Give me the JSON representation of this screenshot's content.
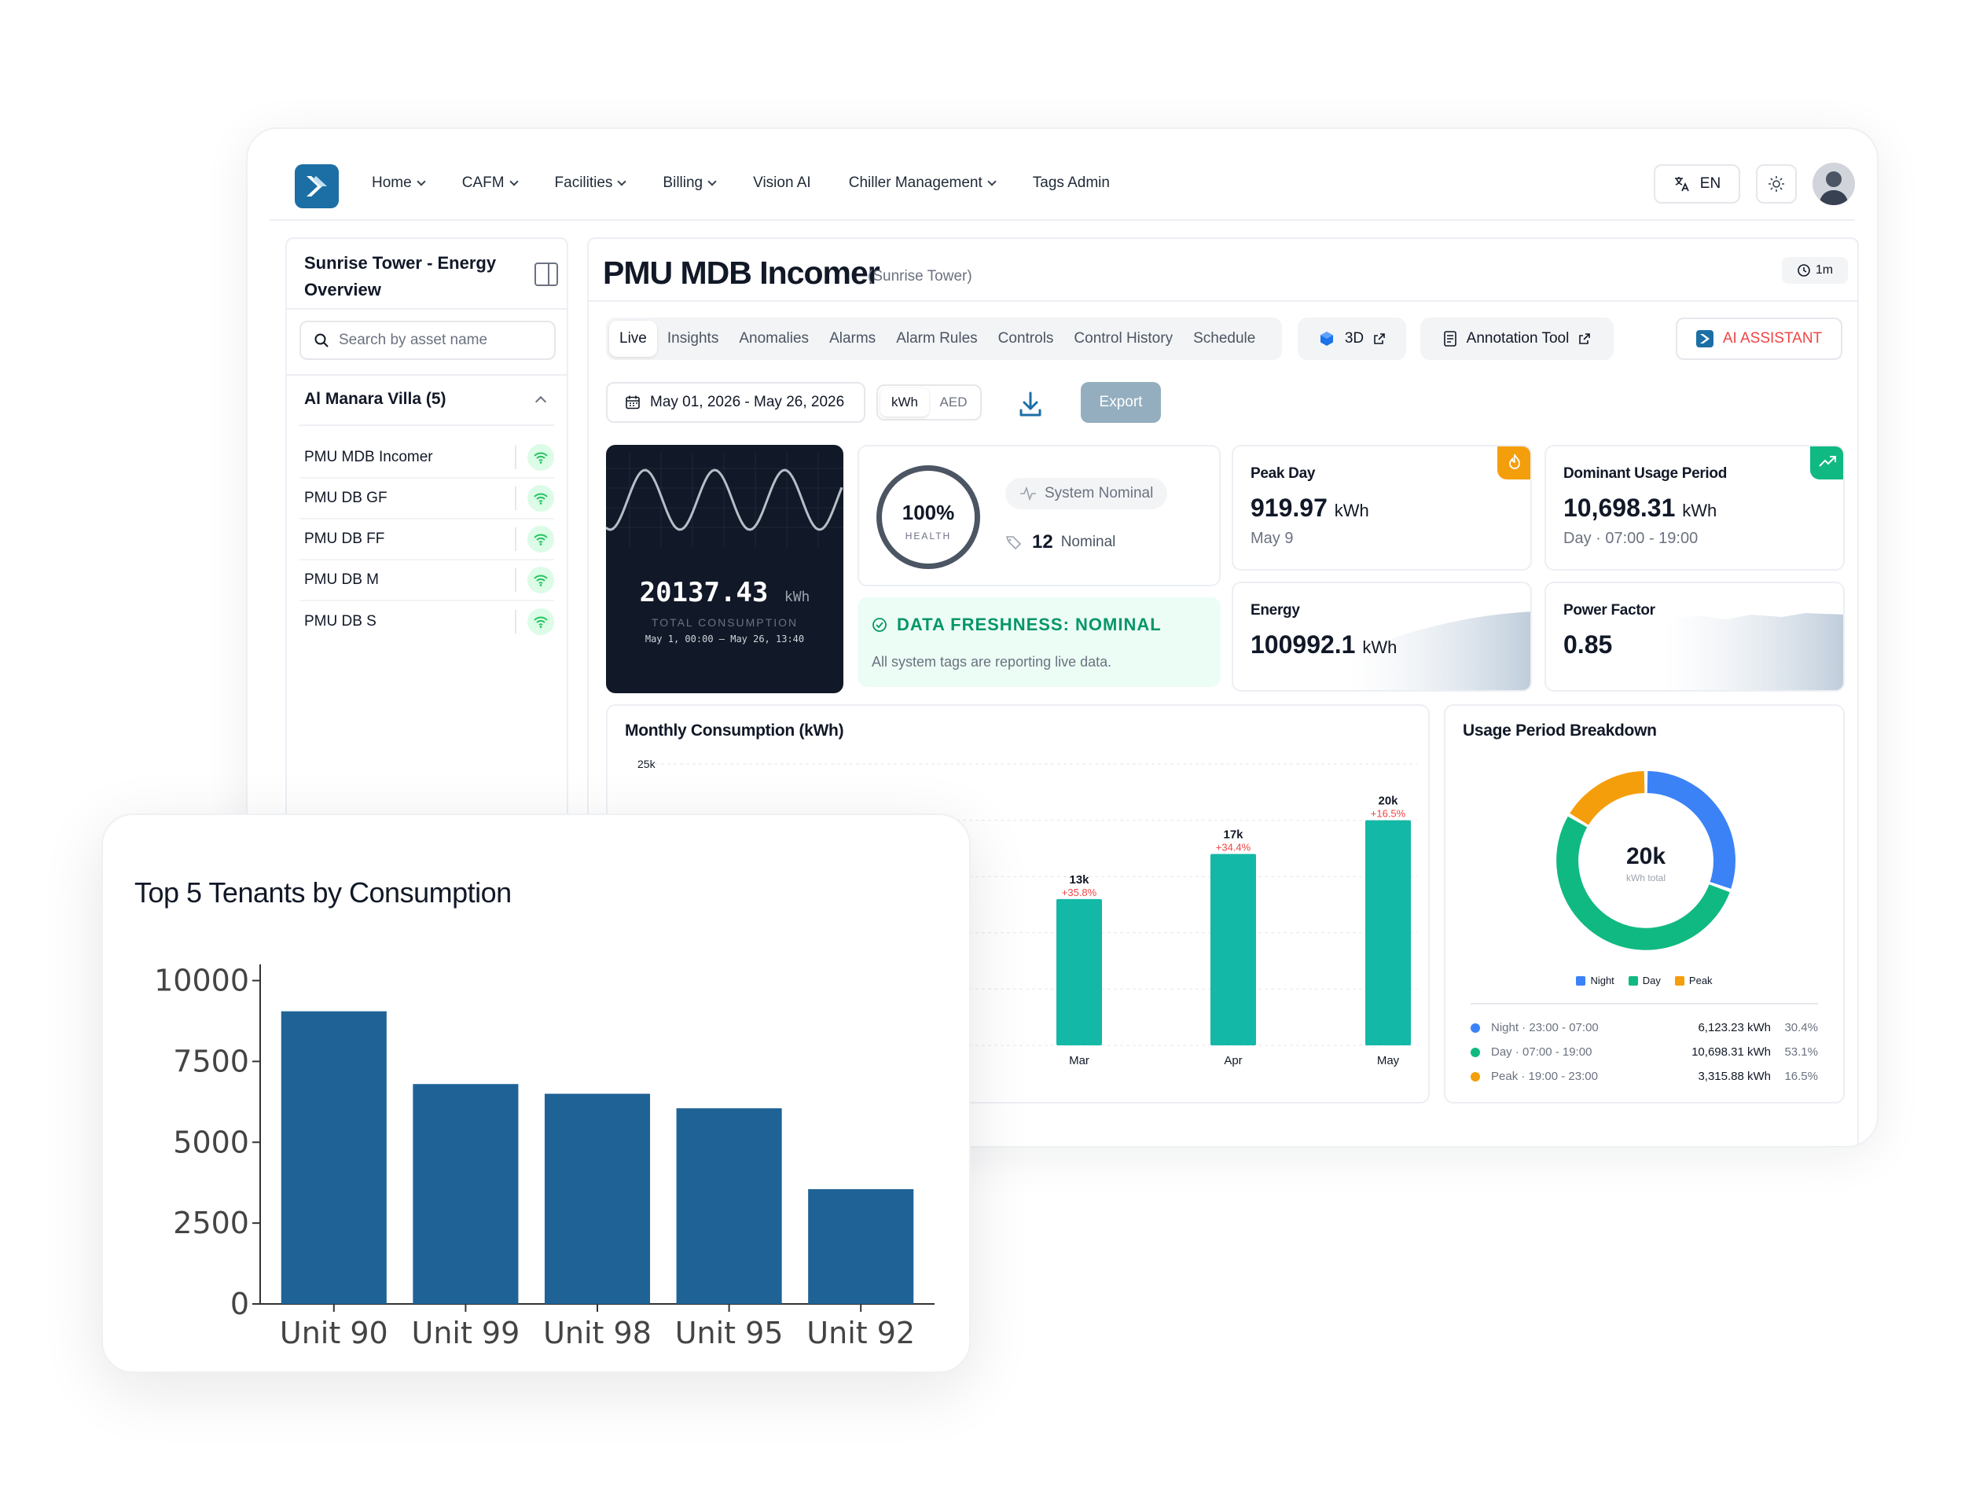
{
  "nav": {
    "items": [
      {
        "label": "Home",
        "dropdown": true
      },
      {
        "label": "CAFM",
        "dropdown": true
      },
      {
        "label": "Facilities",
        "dropdown": true
      },
      {
        "label": "Billing",
        "dropdown": true
      },
      {
        "label": "Vision AI",
        "dropdown": false
      },
      {
        "label": "Chiller Management",
        "dropdown": true
      },
      {
        "label": "Tags Admin",
        "dropdown": false
      }
    ],
    "language": "EN"
  },
  "sidebar": {
    "title": "Sunrise Tower - Energy Overview",
    "search_placeholder": "Search by asset name",
    "group_label": "Al Manara Villa (5)",
    "assets": [
      "PMU MDB Incomer",
      "PMU DB GF",
      "PMU DB FF",
      "PMU DB M",
      "PMU DB S"
    ]
  },
  "header": {
    "title": "PMU MDB Incomer",
    "subtitle": "(Sunrise Tower)",
    "refresh": "1m"
  },
  "tabs": [
    "Live",
    "Insights",
    "Anomalies",
    "Alarms",
    "Alarm Rules",
    "Controls",
    "Control History",
    "Schedule"
  ],
  "actions": {
    "btn_3d": "3D",
    "annotation": "Annotation Tool",
    "ai": "AI ASSISTANT"
  },
  "toolbar": {
    "date_range": "May 01, 2026 - May 26, 2026",
    "unit_kwh": "kWh",
    "unit_aed": "AED",
    "export": "Export"
  },
  "consumption": {
    "value": "20137.43",
    "unit": "kWh",
    "label": "TOTAL CONSUMPTION",
    "range": "May 1, 00:00 – May 26, 13:40"
  },
  "health": {
    "value": "100%",
    "label": "HEALTH",
    "status": "System Nominal",
    "nominal_count": "12",
    "nominal_label": "Nominal"
  },
  "freshness": {
    "title": "DATA FRESHNESS: NOMINAL",
    "subtitle": "All system tags are reporting live data."
  },
  "kpis": {
    "peak_day": {
      "title": "Peak Day",
      "value": "919.97",
      "unit": "kWh",
      "sub": "May 9"
    },
    "dominant": {
      "title": "Dominant Usage Period",
      "value": "10,698.31",
      "unit": "kWh",
      "sub": "Day · 07:00 - 19:00"
    },
    "energy": {
      "title": "Energy",
      "value": "100992.1",
      "unit": "kWh"
    },
    "power_factor": {
      "title": "Power Factor",
      "value": "0.85"
    }
  },
  "colors": {
    "accent_blue": "#1c6fa5",
    "teal": "#14b8a6",
    "night": "#3b82f6",
    "day": "#10b981",
    "peak": "#f59e0b",
    "danger": "#ef4444",
    "tenant_bar": "#1f6396"
  },
  "chart_data": [
    {
      "type": "bar",
      "title": "Monthly Consumption (kWh)",
      "categories": [
        "Mar",
        "Apr",
        "May"
      ],
      "values": [
        13000,
        17000,
        20000
      ],
      "data_labels": [
        "13k",
        "17k",
        "20k"
      ],
      "change_labels": [
        "+35.8%",
        "+34.4%",
        "+16.5%"
      ],
      "y_tick_labels": [
        "25k"
      ],
      "ylim": [
        0,
        25000
      ],
      "grid": true
    },
    {
      "type": "pie",
      "title": "Usage Period Breakdown",
      "center_value": "20k",
      "center_label": "kWh total",
      "legend": [
        "Night",
        "Day",
        "Peak"
      ],
      "slices": [
        {
          "name": "Night",
          "period": "Night · 23:00 - 07:00",
          "value": 6123.23,
          "value_label": "6,123.23 kWh",
          "pct": "30.4%"
        },
        {
          "name": "Day",
          "period": "Day · 07:00 - 19:00",
          "value": 10698.31,
          "value_label": "10,698.31 kWh",
          "pct": "53.1%"
        },
        {
          "name": "Peak",
          "period": "Peak · 19:00 - 23:00",
          "value": 3315.88,
          "value_label": "3,315.88 kWh",
          "pct": "16.5%"
        }
      ]
    },
    {
      "type": "bar",
      "title": "Top 5 Tenants by Consumption",
      "categories": [
        "Unit 90",
        "Unit 99",
        "Unit 98",
        "Unit 95",
        "Unit 92"
      ],
      "values": [
        9050,
        6800,
        6500,
        6050,
        3550
      ],
      "y_ticks": [
        0,
        2500,
        5000,
        7500,
        10000
      ],
      "ylim": [
        0,
        10500
      ],
      "grid": false
    }
  ]
}
